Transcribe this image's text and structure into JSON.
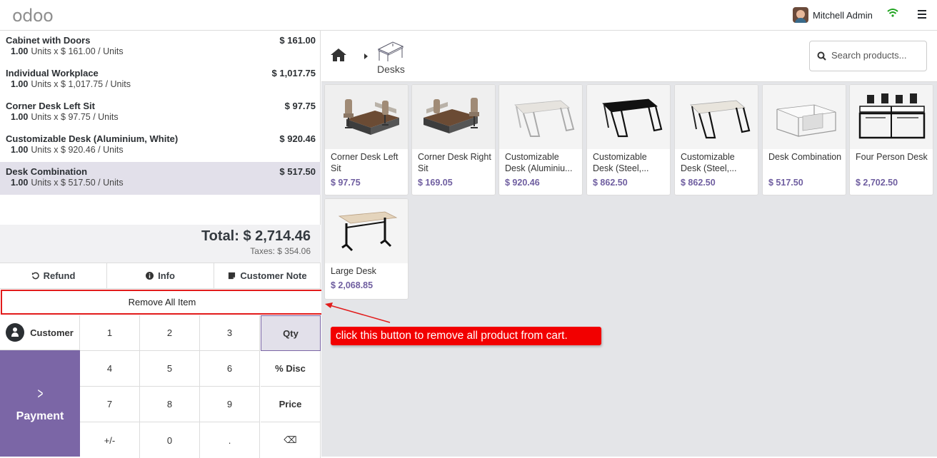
{
  "brand": {
    "logo_text": "odoo"
  },
  "header": {
    "user_name": "Mitchell Admin"
  },
  "orderlines": [
    {
      "name": "Cabinet with Doors",
      "price": "$ 161.00",
      "qty": "1.00",
      "detail": "Units x $ 161.00 / Units",
      "selected": false
    },
    {
      "name": "Individual Workplace",
      "price": "$ 1,017.75",
      "qty": "1.00",
      "detail": "Units x $ 1,017.75 / Units",
      "selected": false
    },
    {
      "name": "Corner Desk Left Sit",
      "price": "$ 97.75",
      "qty": "1.00",
      "detail": "Units x $ 97.75 / Units",
      "selected": false
    },
    {
      "name": "Customizable Desk (Aluminium, White)",
      "price": "$ 920.46",
      "qty": "1.00",
      "detail": "Units x $ 920.46 / Units",
      "selected": false
    },
    {
      "name": "Desk Combination",
      "price": "$ 517.50",
      "qty": "1.00",
      "detail": "Units x $ 517.50 / Units",
      "selected": true
    }
  ],
  "totals": {
    "total": "Total: $ 2,714.46",
    "taxes": "Taxes: $ 354.06"
  },
  "actions": {
    "refund": "Refund",
    "info": "Info",
    "customer_note": "Customer Note"
  },
  "remove_all": "Remove All Item",
  "pad": {
    "customer": "Customer",
    "payment": "Payment",
    "keys": [
      [
        "1",
        "2",
        "3",
        "Qty"
      ],
      [
        "4",
        "5",
        "6",
        "% Disc"
      ],
      [
        "7",
        "8",
        "9",
        "Price"
      ],
      [
        "+/-",
        "0",
        ".",
        "⌫"
      ]
    ],
    "active_mode": "Qty"
  },
  "breadcrumb": {
    "category": "Desks"
  },
  "search": {
    "placeholder": "Search products..."
  },
  "products": [
    {
      "name": "Corner Desk Left Sit",
      "price": "$ 97.75",
      "img": "office"
    },
    {
      "name": "Corner Desk Right Sit",
      "price": "$ 169.05",
      "img": "office"
    },
    {
      "name": "Customizable Desk (Aluminiu...",
      "price": "$ 920.46",
      "img": "white-desk"
    },
    {
      "name": "Customizable Desk (Steel,...",
      "price": "$ 862.50",
      "img": "black-desk"
    },
    {
      "name": "Customizable Desk (Steel,...",
      "price": "$ 862.50",
      "img": "white-desk"
    },
    {
      "name": "Desk Combination",
      "price": "$ 517.50",
      "img": "combo"
    },
    {
      "name": "Four Person Desk",
      "price": "$ 2,702.50",
      "img": "four"
    },
    {
      "name": "Large Desk",
      "price": "$ 2,068.85",
      "img": "large"
    }
  ],
  "annotation": {
    "text": "click this button to remove all product from cart."
  },
  "colors": {
    "accent": "#7b66a6",
    "price": "#6f5ea0",
    "annotation": "#f20000",
    "selected_row": "#e2e0ea"
  }
}
